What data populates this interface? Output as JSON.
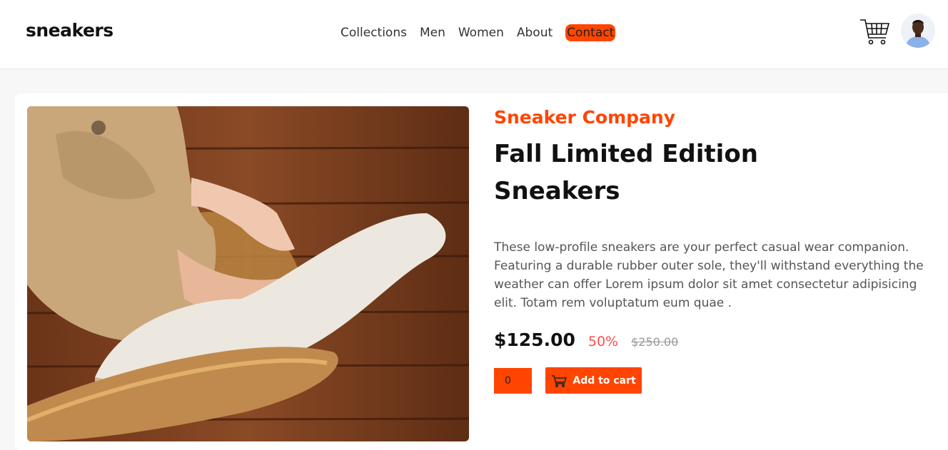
{
  "brand": {
    "logo": "sneakers",
    "accent_color": "#ff4500"
  },
  "nav": {
    "items": [
      {
        "label": "Collections"
      },
      {
        "label": "Men"
      },
      {
        "label": "Women"
      },
      {
        "label": "About"
      },
      {
        "label": "Contact",
        "active": true
      }
    ]
  },
  "header": {
    "cart_icon": "cart-icon",
    "avatar_icon": "avatar"
  },
  "product": {
    "company": "Sneaker Company",
    "title": "Fall Limited Edition Sneakers",
    "description": "These low-profile sneakers are your perfect casual wear companion. Featuring a durable rubber outer sole, they'll withstand everything the weather can offer Lorem ipsum dolor sit amet consectetur adipisicing elit. Totam rem voluptatum eum quae .",
    "price": "$125.00",
    "discount": "50%",
    "original_price": "$250.00",
    "quantity": "0",
    "add_to_cart_label": "Add to cart"
  }
}
